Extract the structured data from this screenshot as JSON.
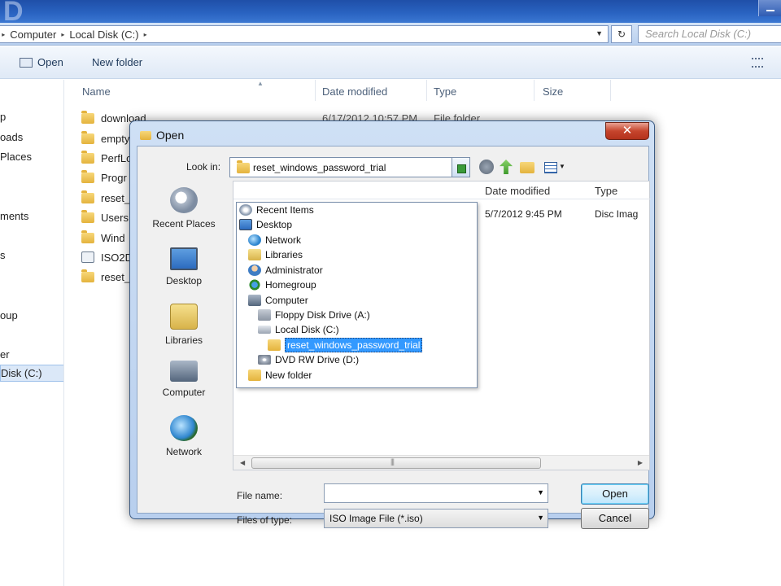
{
  "explorer": {
    "breadcrumb": [
      "Computer",
      "Local Disk (C:)"
    ],
    "search_placeholder": "Search Local Disk (C:)",
    "toolbar": {
      "open_label": "Open",
      "new_folder_label": "New folder"
    },
    "nav_items": [
      "p",
      "oads",
      "Places",
      "ments",
      "s",
      "oup",
      "er",
      "Disk (C:)"
    ],
    "columns": {
      "name": "Name",
      "date": "Date modified",
      "type": "Type",
      "size": "Size"
    },
    "files": [
      {
        "name": "download",
        "kind": "folder"
      },
      {
        "name": "empty",
        "kind": "folder"
      },
      {
        "name": "PerfLo",
        "kind": "folder"
      },
      {
        "name": "Progr",
        "kind": "folder"
      },
      {
        "name": "reset_",
        "kind": "folder"
      },
      {
        "name": "Users",
        "kind": "folder"
      },
      {
        "name": "Wind",
        "kind": "folder"
      },
      {
        "name": "ISO2D",
        "kind": "iso"
      },
      {
        "name": "reset_",
        "kind": "folder"
      }
    ],
    "first_row_date": "6/17/2012 10:57 PM",
    "first_row_type": "File folder"
  },
  "dialog": {
    "title": "Open",
    "close_symbol": "✕",
    "look_in_label": "Look in:",
    "look_in_value": "reset_windows_password_trial",
    "places": [
      "Recent Places",
      "Desktop",
      "Libraries",
      "Computer",
      "Network"
    ],
    "columns": {
      "date": "Date modified",
      "type": "Type"
    },
    "file_row": {
      "date": "5/7/2012 9:45 PM",
      "type": "Disc Imag"
    },
    "dropdown_items": [
      {
        "label": "Recent Items",
        "icon": "recent"
      },
      {
        "label": "Desktop",
        "icon": "desktop"
      },
      {
        "label": "Network",
        "icon": "network"
      },
      {
        "label": "Libraries",
        "icon": "libraries"
      },
      {
        "label": "Administrator",
        "icon": "admin"
      },
      {
        "label": "Homegroup",
        "icon": "homegroup"
      },
      {
        "label": "Computer",
        "icon": "computer"
      },
      {
        "label": "Floppy Disk Drive (A:)",
        "icon": "floppy"
      },
      {
        "label": "Local Disk (C:)",
        "icon": "disk"
      },
      {
        "label": "reset_windows_password_trial",
        "icon": "folder",
        "selected": true
      },
      {
        "label": "DVD RW Drive (D:)",
        "icon": "dvd"
      },
      {
        "label": "New folder",
        "icon": "folder"
      }
    ],
    "file_name_label": "File name:",
    "file_name_value": "",
    "file_type_label": "Files of type:",
    "file_type_value": "ISO Image File (*.iso)",
    "open_button": "Open",
    "cancel_button": "Cancel"
  }
}
